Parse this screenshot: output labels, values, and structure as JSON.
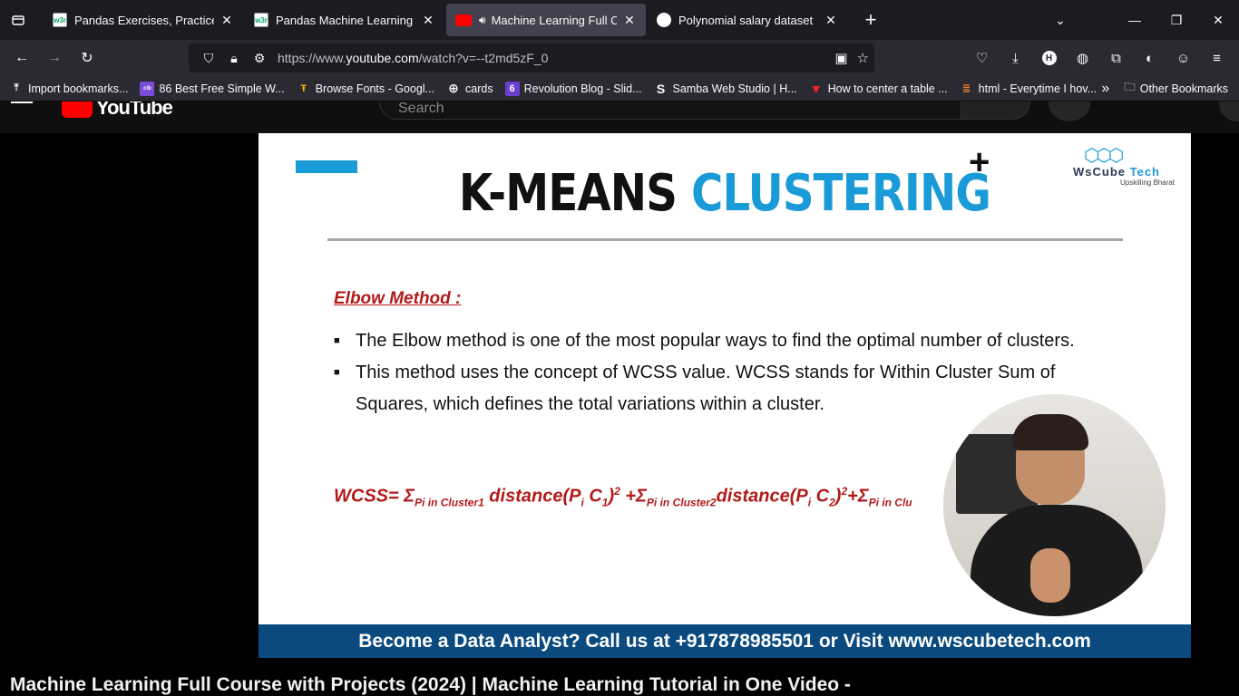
{
  "tabs": [
    {
      "title": "Pandas Exercises, Practice, Soluti",
      "favicon": "w3r",
      "active": false
    },
    {
      "title": "Pandas Machine Learning Integ",
      "favicon": "w3r",
      "active": false
    },
    {
      "title": "Machine Learning Full Cour",
      "favicon": "youtube",
      "active": true
    },
    {
      "title": "Polynomial salary dataset",
      "favicon": "chatgpt",
      "active": false
    }
  ],
  "address_bar": {
    "url_prefix": "https://www.",
    "url_domain": "youtube.com",
    "url_path": "/watch?v=--t2md5zF_0"
  },
  "bookmarks": [
    {
      "label": "Import bookmarks...",
      "icon": "import-icon"
    },
    {
      "label": "86 Best Free Simple W...",
      "icon": "colorlib-icon"
    },
    {
      "label": "Browse Fonts - Googl...",
      "icon": "google-fonts-icon"
    },
    {
      "label": "cards",
      "icon": "globe-icon"
    },
    {
      "label": "Revolution Blog - Slid...",
      "icon": "revolution-icon"
    },
    {
      "label": "Samba Web Studio | H...",
      "icon": "samba-icon"
    },
    {
      "label": "How to center a table ...",
      "icon": "vue-icon"
    },
    {
      "label": "html - Everytime I hov...",
      "icon": "stackoverflow-icon"
    }
  ],
  "other_bookmarks": "Other Bookmarks",
  "youtube": {
    "search_placeholder": "Search",
    "logo_text": "YouTube"
  },
  "slide": {
    "title_part1": "K-MEANS ",
    "title_part2": "CLUSTERING",
    "brand_name_1": "WsCube",
    "brand_name_2": " Tech",
    "brand_tagline": "Upskilling Bharat",
    "section_heading": "Elbow Method :",
    "bullets": [
      "The Elbow method is one of the most popular ways to find the optimal number of clusters.",
      "This method uses the concept of WCSS value. WCSS stands for Within Cluster Sum of Squares, which defines the total variations within a cluster."
    ],
    "formula": {
      "lhs": "WCSS= ",
      "sigma": "Σ",
      "sub1": "Pi in Cluster1",
      "term1": " distance(P",
      "i": "i",
      "c1": " C",
      "one": "1",
      "close": ")",
      "two": "2",
      "plus": " +",
      "sub2": "Pi in Cluster2",
      "term2": "distance(P",
      "c2": " C",
      "two_b": "2",
      "plus2": "+",
      "sub3": "Pi in Clu"
    },
    "cta": "Become a Data Analyst? Call us at +917878985501 or Visit www.wscubetech.com"
  },
  "video_title": "Machine Learning Full Course with Projects (2024) | Machine Learning Tutorial in One Video -"
}
